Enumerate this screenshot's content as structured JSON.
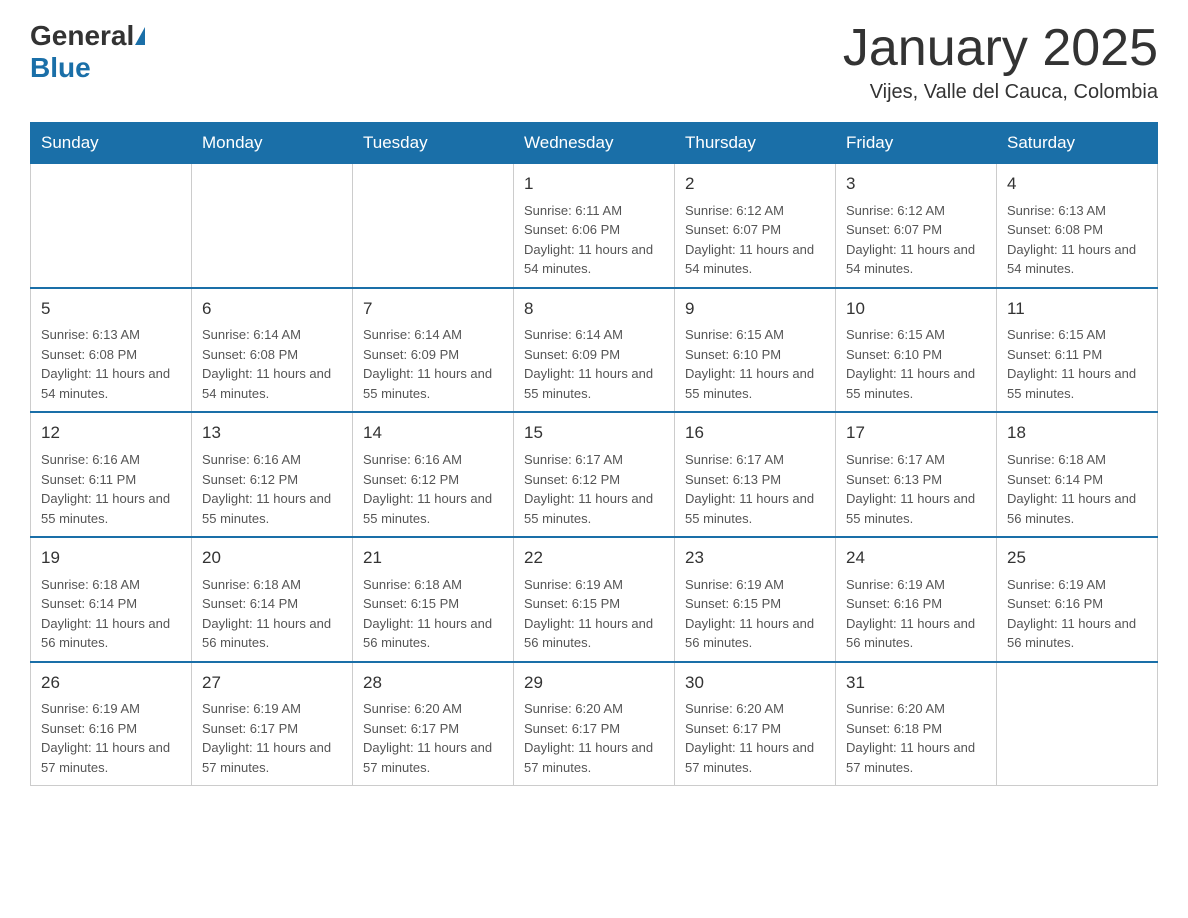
{
  "header": {
    "logo_general": "General",
    "logo_blue": "Blue",
    "title": "January 2025",
    "subtitle": "Vijes, Valle del Cauca, Colombia"
  },
  "days_of_week": [
    "Sunday",
    "Monday",
    "Tuesday",
    "Wednesday",
    "Thursday",
    "Friday",
    "Saturday"
  ],
  "weeks": [
    {
      "cells": [
        {
          "day": "",
          "info": ""
        },
        {
          "day": "",
          "info": ""
        },
        {
          "day": "",
          "info": ""
        },
        {
          "day": "1",
          "info": "Sunrise: 6:11 AM\nSunset: 6:06 PM\nDaylight: 11 hours and 54 minutes."
        },
        {
          "day": "2",
          "info": "Sunrise: 6:12 AM\nSunset: 6:07 PM\nDaylight: 11 hours and 54 minutes."
        },
        {
          "day": "3",
          "info": "Sunrise: 6:12 AM\nSunset: 6:07 PM\nDaylight: 11 hours and 54 minutes."
        },
        {
          "day": "4",
          "info": "Sunrise: 6:13 AM\nSunset: 6:08 PM\nDaylight: 11 hours and 54 minutes."
        }
      ]
    },
    {
      "cells": [
        {
          "day": "5",
          "info": "Sunrise: 6:13 AM\nSunset: 6:08 PM\nDaylight: 11 hours and 54 minutes."
        },
        {
          "day": "6",
          "info": "Sunrise: 6:14 AM\nSunset: 6:08 PM\nDaylight: 11 hours and 54 minutes."
        },
        {
          "day": "7",
          "info": "Sunrise: 6:14 AM\nSunset: 6:09 PM\nDaylight: 11 hours and 55 minutes."
        },
        {
          "day": "8",
          "info": "Sunrise: 6:14 AM\nSunset: 6:09 PM\nDaylight: 11 hours and 55 minutes."
        },
        {
          "day": "9",
          "info": "Sunrise: 6:15 AM\nSunset: 6:10 PM\nDaylight: 11 hours and 55 minutes."
        },
        {
          "day": "10",
          "info": "Sunrise: 6:15 AM\nSunset: 6:10 PM\nDaylight: 11 hours and 55 minutes."
        },
        {
          "day": "11",
          "info": "Sunrise: 6:15 AM\nSunset: 6:11 PM\nDaylight: 11 hours and 55 minutes."
        }
      ]
    },
    {
      "cells": [
        {
          "day": "12",
          "info": "Sunrise: 6:16 AM\nSunset: 6:11 PM\nDaylight: 11 hours and 55 minutes."
        },
        {
          "day": "13",
          "info": "Sunrise: 6:16 AM\nSunset: 6:12 PM\nDaylight: 11 hours and 55 minutes."
        },
        {
          "day": "14",
          "info": "Sunrise: 6:16 AM\nSunset: 6:12 PM\nDaylight: 11 hours and 55 minutes."
        },
        {
          "day": "15",
          "info": "Sunrise: 6:17 AM\nSunset: 6:12 PM\nDaylight: 11 hours and 55 minutes."
        },
        {
          "day": "16",
          "info": "Sunrise: 6:17 AM\nSunset: 6:13 PM\nDaylight: 11 hours and 55 minutes."
        },
        {
          "day": "17",
          "info": "Sunrise: 6:17 AM\nSunset: 6:13 PM\nDaylight: 11 hours and 55 minutes."
        },
        {
          "day": "18",
          "info": "Sunrise: 6:18 AM\nSunset: 6:14 PM\nDaylight: 11 hours and 56 minutes."
        }
      ]
    },
    {
      "cells": [
        {
          "day": "19",
          "info": "Sunrise: 6:18 AM\nSunset: 6:14 PM\nDaylight: 11 hours and 56 minutes."
        },
        {
          "day": "20",
          "info": "Sunrise: 6:18 AM\nSunset: 6:14 PM\nDaylight: 11 hours and 56 minutes."
        },
        {
          "day": "21",
          "info": "Sunrise: 6:18 AM\nSunset: 6:15 PM\nDaylight: 11 hours and 56 minutes."
        },
        {
          "day": "22",
          "info": "Sunrise: 6:19 AM\nSunset: 6:15 PM\nDaylight: 11 hours and 56 minutes."
        },
        {
          "day": "23",
          "info": "Sunrise: 6:19 AM\nSunset: 6:15 PM\nDaylight: 11 hours and 56 minutes."
        },
        {
          "day": "24",
          "info": "Sunrise: 6:19 AM\nSunset: 6:16 PM\nDaylight: 11 hours and 56 minutes."
        },
        {
          "day": "25",
          "info": "Sunrise: 6:19 AM\nSunset: 6:16 PM\nDaylight: 11 hours and 56 minutes."
        }
      ]
    },
    {
      "cells": [
        {
          "day": "26",
          "info": "Sunrise: 6:19 AM\nSunset: 6:16 PM\nDaylight: 11 hours and 57 minutes."
        },
        {
          "day": "27",
          "info": "Sunrise: 6:19 AM\nSunset: 6:17 PM\nDaylight: 11 hours and 57 minutes."
        },
        {
          "day": "28",
          "info": "Sunrise: 6:20 AM\nSunset: 6:17 PM\nDaylight: 11 hours and 57 minutes."
        },
        {
          "day": "29",
          "info": "Sunrise: 6:20 AM\nSunset: 6:17 PM\nDaylight: 11 hours and 57 minutes."
        },
        {
          "day": "30",
          "info": "Sunrise: 6:20 AM\nSunset: 6:17 PM\nDaylight: 11 hours and 57 minutes."
        },
        {
          "day": "31",
          "info": "Sunrise: 6:20 AM\nSunset: 6:18 PM\nDaylight: 11 hours and 57 minutes."
        },
        {
          "day": "",
          "info": ""
        }
      ]
    }
  ]
}
